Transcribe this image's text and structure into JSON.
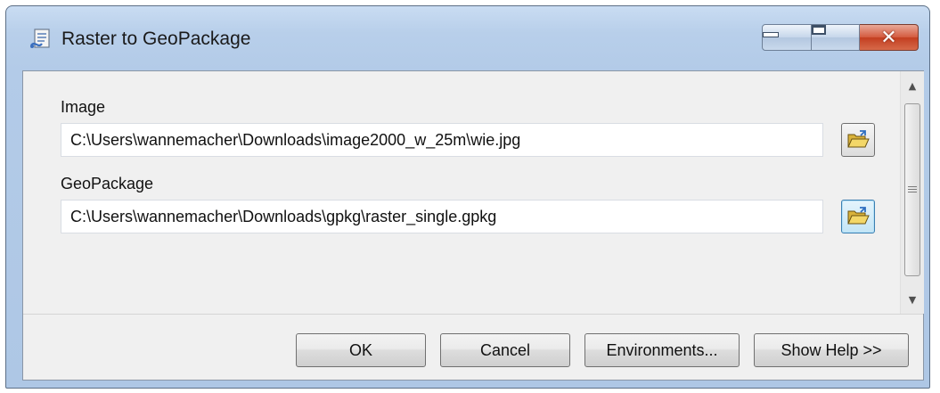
{
  "window": {
    "title": "Raster to GeoPackage",
    "controls": {
      "minimize": "minimize",
      "maximize": "maximize",
      "close": "✕"
    }
  },
  "form": {
    "image_label": "Image",
    "image_value": "C:\\Users\\wannemacher\\Downloads\\image2000_w_25m\\wie.jpg",
    "geopackage_label": "GeoPackage",
    "geopackage_value": "C:\\Users\\wannemacher\\Downloads\\gpkg\\raster_single.gpkg"
  },
  "scrollbar": {
    "up": "▲",
    "down": "▼"
  },
  "buttons": {
    "ok": "OK",
    "cancel": "Cancel",
    "environments": "Environments...",
    "show_help": "Show Help >>"
  },
  "icons": {
    "app": "tool-script-icon",
    "browse": "open-folder-icon"
  },
  "colors": {
    "title_bar": "#b8cfea",
    "close_button": "#c33e20",
    "focus_blue": "#3c7fb1",
    "folder": "#e6c24a"
  }
}
